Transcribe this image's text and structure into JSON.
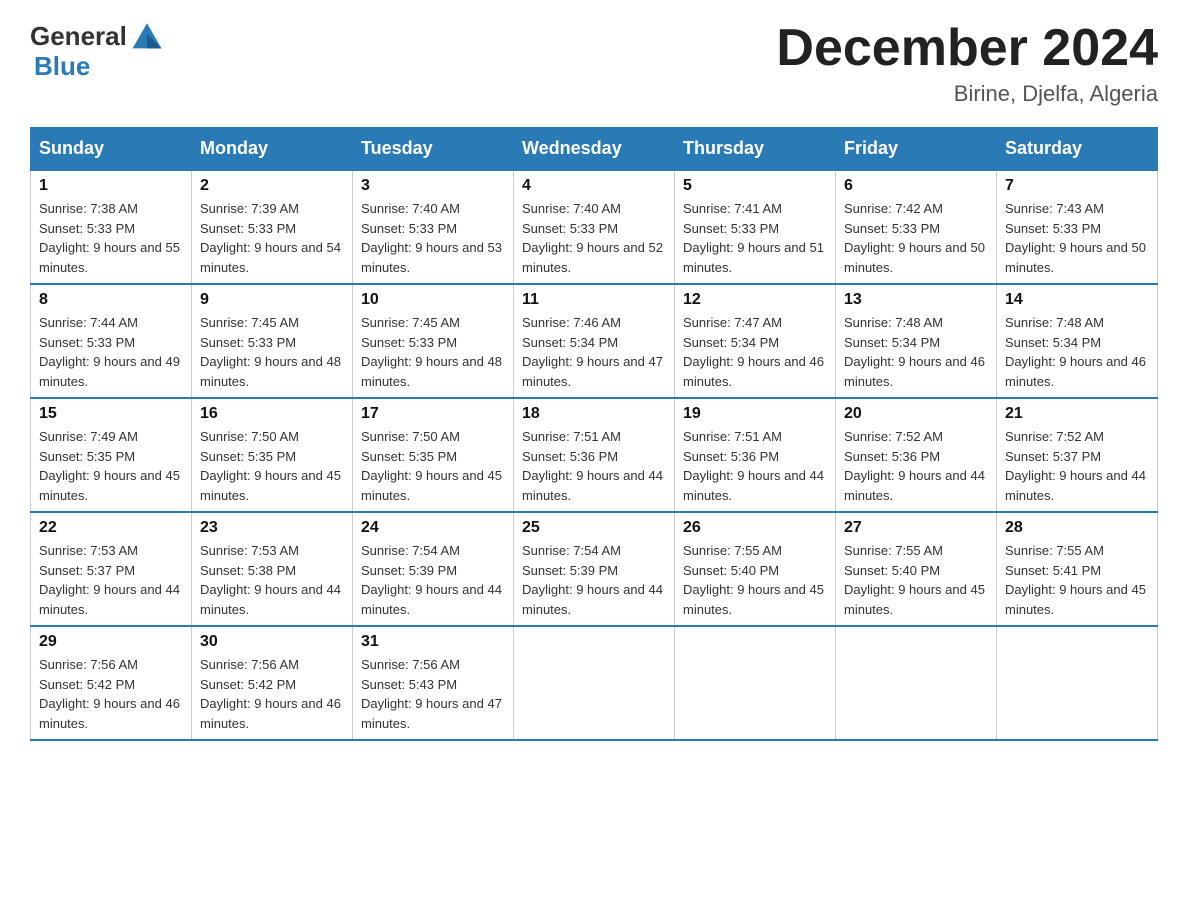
{
  "header": {
    "logo_general": "General",
    "logo_blue": "Blue",
    "month_title": "December 2024",
    "subtitle": "Birine, Djelfa, Algeria"
  },
  "days_of_week": [
    "Sunday",
    "Monday",
    "Tuesday",
    "Wednesday",
    "Thursday",
    "Friday",
    "Saturday"
  ],
  "weeks": [
    [
      {
        "day": "1",
        "sunrise": "7:38 AM",
        "sunset": "5:33 PM",
        "daylight": "9 hours and 55 minutes."
      },
      {
        "day": "2",
        "sunrise": "7:39 AM",
        "sunset": "5:33 PM",
        "daylight": "9 hours and 54 minutes."
      },
      {
        "day": "3",
        "sunrise": "7:40 AM",
        "sunset": "5:33 PM",
        "daylight": "9 hours and 53 minutes."
      },
      {
        "day": "4",
        "sunrise": "7:40 AM",
        "sunset": "5:33 PM",
        "daylight": "9 hours and 52 minutes."
      },
      {
        "day": "5",
        "sunrise": "7:41 AM",
        "sunset": "5:33 PM",
        "daylight": "9 hours and 51 minutes."
      },
      {
        "day": "6",
        "sunrise": "7:42 AM",
        "sunset": "5:33 PM",
        "daylight": "9 hours and 50 minutes."
      },
      {
        "day": "7",
        "sunrise": "7:43 AM",
        "sunset": "5:33 PM",
        "daylight": "9 hours and 50 minutes."
      }
    ],
    [
      {
        "day": "8",
        "sunrise": "7:44 AM",
        "sunset": "5:33 PM",
        "daylight": "9 hours and 49 minutes."
      },
      {
        "day": "9",
        "sunrise": "7:45 AM",
        "sunset": "5:33 PM",
        "daylight": "9 hours and 48 minutes."
      },
      {
        "day": "10",
        "sunrise": "7:45 AM",
        "sunset": "5:33 PM",
        "daylight": "9 hours and 48 minutes."
      },
      {
        "day": "11",
        "sunrise": "7:46 AM",
        "sunset": "5:34 PM",
        "daylight": "9 hours and 47 minutes."
      },
      {
        "day": "12",
        "sunrise": "7:47 AM",
        "sunset": "5:34 PM",
        "daylight": "9 hours and 46 minutes."
      },
      {
        "day": "13",
        "sunrise": "7:48 AM",
        "sunset": "5:34 PM",
        "daylight": "9 hours and 46 minutes."
      },
      {
        "day": "14",
        "sunrise": "7:48 AM",
        "sunset": "5:34 PM",
        "daylight": "9 hours and 46 minutes."
      }
    ],
    [
      {
        "day": "15",
        "sunrise": "7:49 AM",
        "sunset": "5:35 PM",
        "daylight": "9 hours and 45 minutes."
      },
      {
        "day": "16",
        "sunrise": "7:50 AM",
        "sunset": "5:35 PM",
        "daylight": "9 hours and 45 minutes."
      },
      {
        "day": "17",
        "sunrise": "7:50 AM",
        "sunset": "5:35 PM",
        "daylight": "9 hours and 45 minutes."
      },
      {
        "day": "18",
        "sunrise": "7:51 AM",
        "sunset": "5:36 PM",
        "daylight": "9 hours and 44 minutes."
      },
      {
        "day": "19",
        "sunrise": "7:51 AM",
        "sunset": "5:36 PM",
        "daylight": "9 hours and 44 minutes."
      },
      {
        "day": "20",
        "sunrise": "7:52 AM",
        "sunset": "5:36 PM",
        "daylight": "9 hours and 44 minutes."
      },
      {
        "day": "21",
        "sunrise": "7:52 AM",
        "sunset": "5:37 PM",
        "daylight": "9 hours and 44 minutes."
      }
    ],
    [
      {
        "day": "22",
        "sunrise": "7:53 AM",
        "sunset": "5:37 PM",
        "daylight": "9 hours and 44 minutes."
      },
      {
        "day": "23",
        "sunrise": "7:53 AM",
        "sunset": "5:38 PM",
        "daylight": "9 hours and 44 minutes."
      },
      {
        "day": "24",
        "sunrise": "7:54 AM",
        "sunset": "5:39 PM",
        "daylight": "9 hours and 44 minutes."
      },
      {
        "day": "25",
        "sunrise": "7:54 AM",
        "sunset": "5:39 PM",
        "daylight": "9 hours and 44 minutes."
      },
      {
        "day": "26",
        "sunrise": "7:55 AM",
        "sunset": "5:40 PM",
        "daylight": "9 hours and 45 minutes."
      },
      {
        "day": "27",
        "sunrise": "7:55 AM",
        "sunset": "5:40 PM",
        "daylight": "9 hours and 45 minutes."
      },
      {
        "day": "28",
        "sunrise": "7:55 AM",
        "sunset": "5:41 PM",
        "daylight": "9 hours and 45 minutes."
      }
    ],
    [
      {
        "day": "29",
        "sunrise": "7:56 AM",
        "sunset": "5:42 PM",
        "daylight": "9 hours and 46 minutes."
      },
      {
        "day": "30",
        "sunrise": "7:56 AM",
        "sunset": "5:42 PM",
        "daylight": "9 hours and 46 minutes."
      },
      {
        "day": "31",
        "sunrise": "7:56 AM",
        "sunset": "5:43 PM",
        "daylight": "9 hours and 47 minutes."
      },
      null,
      null,
      null,
      null
    ]
  ]
}
